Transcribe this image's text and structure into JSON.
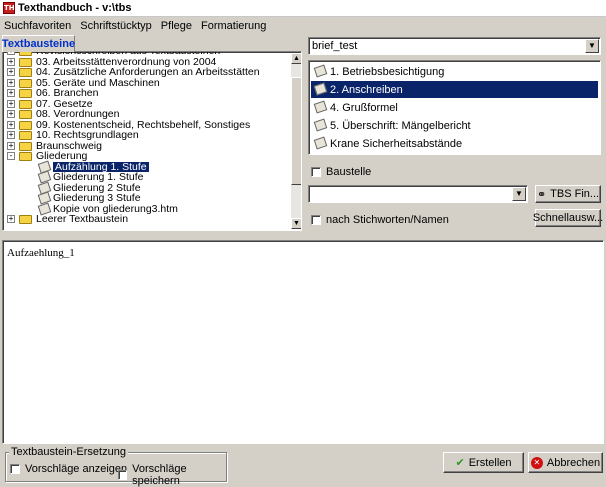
{
  "window": {
    "title": "Texthandbuch - v:\\tbs",
    "icon_label": "TH"
  },
  "menu": [
    "Suchfavoriten",
    "Schriftstücktyp",
    "Pflege",
    "Formatierung"
  ],
  "tab": {
    "label": "Textbausteine"
  },
  "tree": {
    "items": [
      {
        "label": "Revisionsschreiben aus Textbausteinen",
        "expander": "+",
        "icon": "folder",
        "level": 0
      },
      {
        "label": "03. Arbeitsstättenverordnung von 2004",
        "expander": "+",
        "icon": "folder",
        "level": 0
      },
      {
        "label": "04. Zusätzliche Anforderungen an Arbeitsstätten",
        "expander": "+",
        "icon": "folder",
        "level": 0
      },
      {
        "label": "05. Geräte und Maschinen",
        "expander": "+",
        "icon": "folder",
        "level": 0
      },
      {
        "label": "06. Branchen",
        "expander": "+",
        "icon": "folder",
        "level": 0
      },
      {
        "label": "07. Gesetze",
        "expander": "+",
        "icon": "folder",
        "level": 0
      },
      {
        "label": "08. Verordnungen",
        "expander": "+",
        "icon": "folder",
        "level": 0
      },
      {
        "label": "09. Kostenentscheid, Rechtsbehelf, Sonstiges",
        "expander": "+",
        "icon": "folder",
        "level": 0
      },
      {
        "label": "10. Rechtsgrundlagen",
        "expander": "+",
        "icon": "folder",
        "level": 0
      },
      {
        "label": "Braunschweig",
        "expander": "+",
        "icon": "folder",
        "level": 0
      },
      {
        "label": "Gliederung",
        "expander": "-",
        "icon": "folder",
        "level": 0
      },
      {
        "label": "Aufzählung 1. Stufe",
        "expander": "",
        "icon": "doc",
        "level": 1,
        "selected": true
      },
      {
        "label": "Gliederung 1. Stufe",
        "expander": "",
        "icon": "doc",
        "level": 1
      },
      {
        "label": "Gliederung 2 Stufe",
        "expander": "",
        "icon": "doc",
        "level": 1
      },
      {
        "label": "Gliederung 3 Stufe",
        "expander": "",
        "icon": "doc",
        "level": 1
      },
      {
        "label": "Kopie von gliederung3.htm",
        "expander": "",
        "icon": "doc",
        "level": 1
      },
      {
        "label": "Leerer Textbaustein",
        "expander": "+",
        "icon": "folder",
        "level": 0
      }
    ]
  },
  "doc_type_combo": {
    "value": "brief_test"
  },
  "document_list": [
    {
      "label": "1. Betriebsbesichtigung",
      "selected": false
    },
    {
      "label": "2. Anschreiben",
      "selected": true
    },
    {
      "label": "4. Grußformel",
      "selected": false
    },
    {
      "label": "5. Überschrift: Mängelbericht",
      "selected": false
    },
    {
      "label": "Krane Sicherheitsabstände",
      "selected": false
    }
  ],
  "baustelle_checkbox": {
    "label": "Baustelle"
  },
  "search_combo": {
    "value": ""
  },
  "tbs_find_button": {
    "label": "TBS Fin..."
  },
  "keyword_checkbox": {
    "label": "nach Stichworten/Namen"
  },
  "quick_select_button": {
    "label": "Schnellausw..."
  },
  "editor": {
    "text": "Aufzaehlung_1"
  },
  "replacement_group": {
    "title": "Textbaustein-Ersetzung",
    "show_suggestions": "Vorschläge anzeigen",
    "save_suggestions": "Vorschläge speichern"
  },
  "create_button": {
    "label": "Erstellen"
  },
  "cancel_button": {
    "label": "Abbrechen"
  },
  "colors": {
    "selection": "#0a246a",
    "tab_text": "#0030c8",
    "create_icon": "#2a9a2a",
    "cancel_icon": "#d01010"
  }
}
